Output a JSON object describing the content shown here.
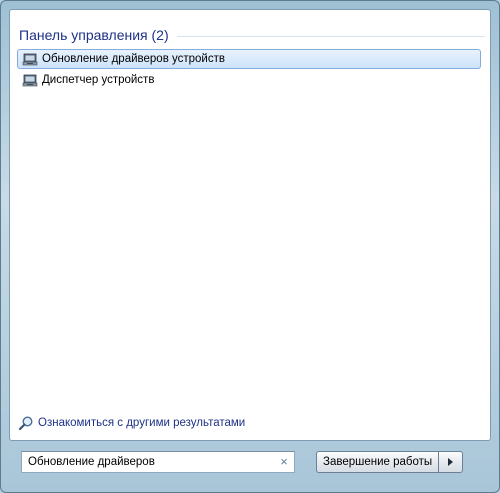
{
  "results": {
    "group_title": "Панель управления (2)",
    "items": [
      {
        "label": "Обновление драйверов устройств",
        "icon": "device-manager-icon",
        "selected": true
      },
      {
        "label": "Диспетчер устройств",
        "icon": "device-manager-icon",
        "selected": false
      }
    ]
  },
  "more_results": {
    "label": "Ознакомиться с другими результатами",
    "icon": "magnifier-icon"
  },
  "search": {
    "value": "Обновление драйверов",
    "clear_icon": "×"
  },
  "shutdown": {
    "label": "Завершение работы",
    "arrow_icon": "arrow-right-icon"
  },
  "colors": {
    "accent_text": "#1e3287",
    "selection_border": "#84acdd",
    "selection_fill": "#cde3fa"
  }
}
